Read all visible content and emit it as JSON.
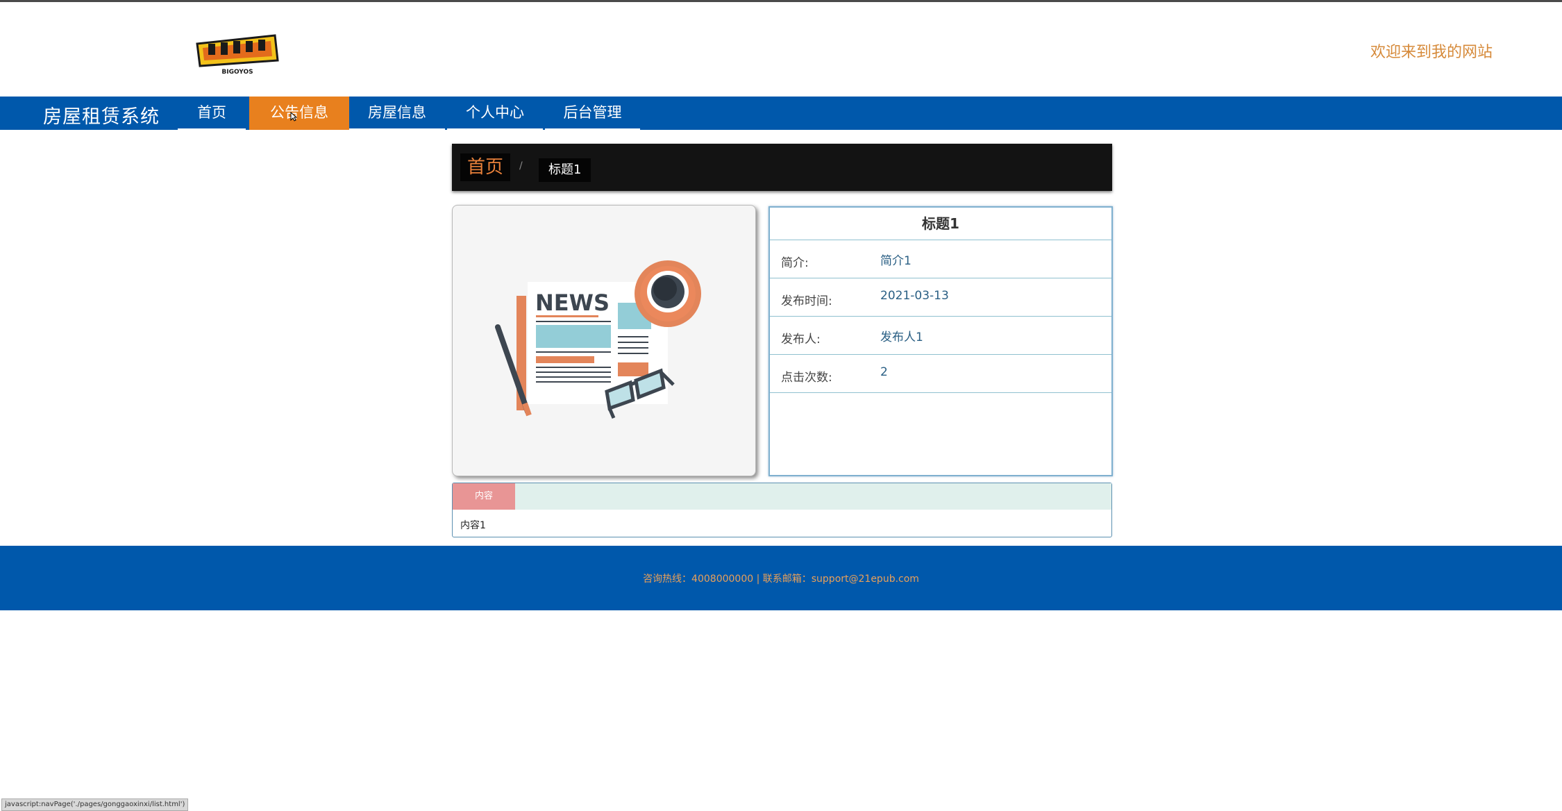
{
  "header": {
    "logo_text": "BIGOYOS",
    "welcome": "欢迎来到我的网站"
  },
  "nav": {
    "brand": "房屋租赁系统",
    "items": [
      {
        "label": "首页"
      },
      {
        "label": "公告信息",
        "active": true
      },
      {
        "label": "房屋信息"
      },
      {
        "label": "个人中心"
      },
      {
        "label": "后台管理"
      }
    ]
  },
  "breadcrumb": {
    "home": "首页",
    "separator": "/",
    "current": "标题1"
  },
  "image": {
    "headline": "NEWS"
  },
  "detail": {
    "title": "标题1",
    "rows": [
      {
        "label": "简介:",
        "value": "简介1"
      },
      {
        "label": "发布时间:",
        "value": "2021-03-13"
      },
      {
        "label": "发布人:",
        "value": "发布人1"
      },
      {
        "label": "点击次数:",
        "value": "2"
      }
    ]
  },
  "content": {
    "tab": "内容",
    "text": "内容1"
  },
  "footer": {
    "text": "咨询热线：4008000000 | 联系邮箱：support@21epub.com"
  },
  "status_bar": {
    "url": "javascript:navPage('./pages/gonggaoxinxi/list.html')"
  },
  "colors": {
    "primary": "#0058ab",
    "accent": "#e8801e",
    "welcome": "#d68a3a"
  }
}
